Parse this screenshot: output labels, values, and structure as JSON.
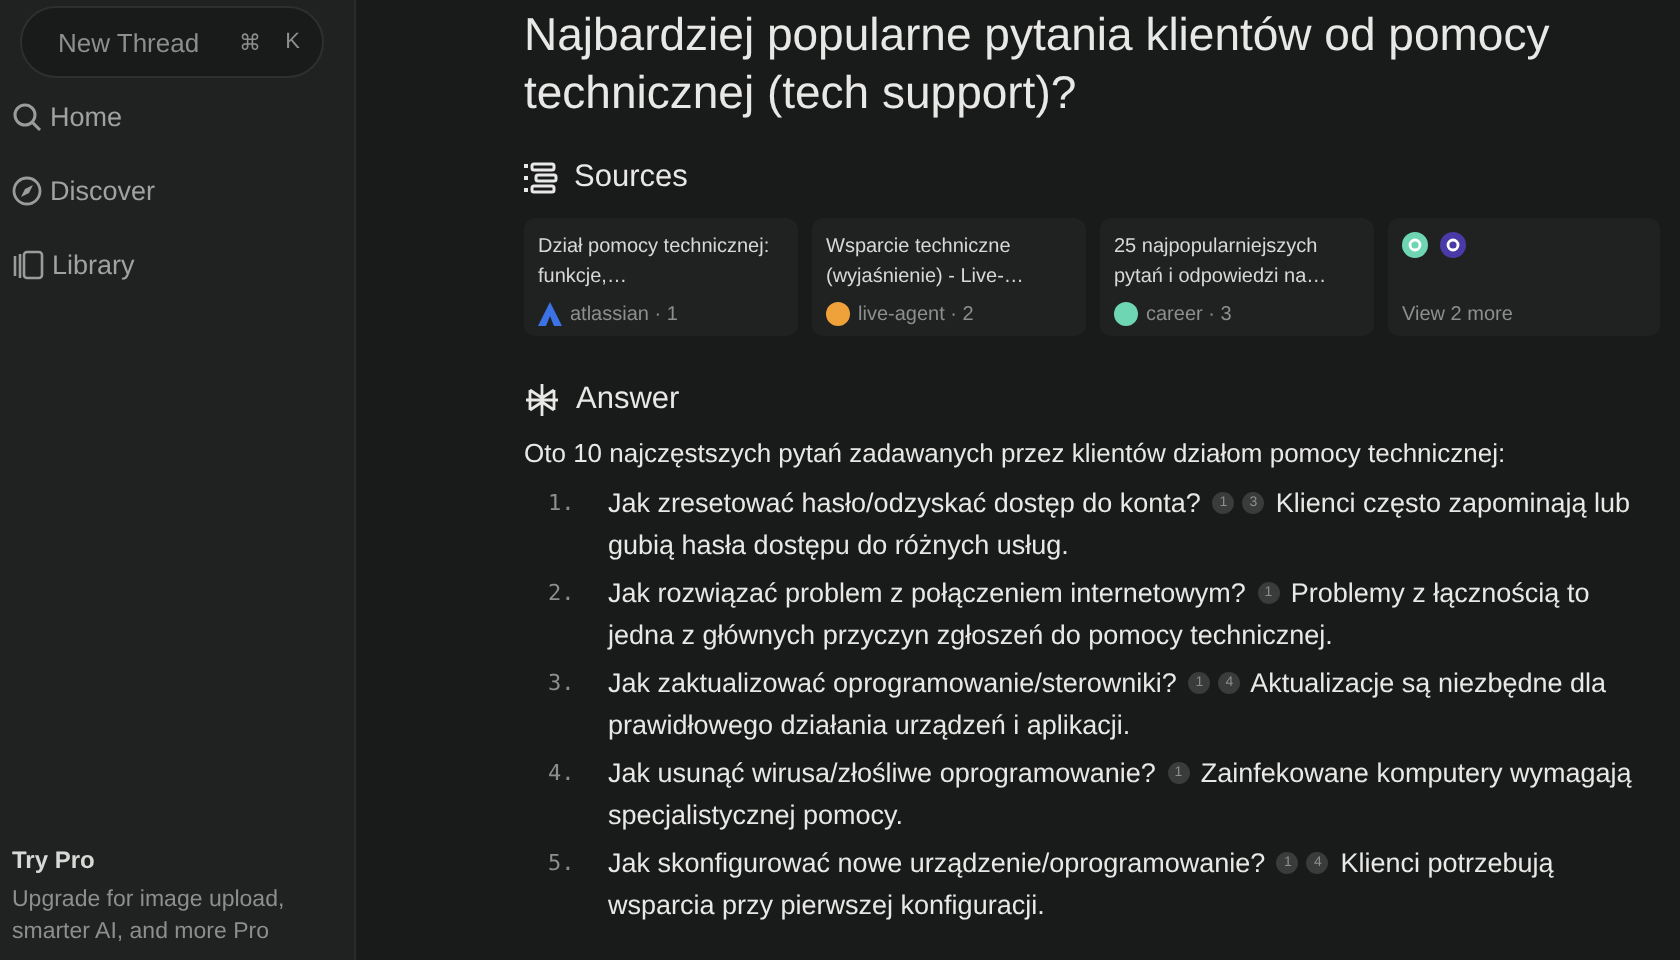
{
  "sidebar": {
    "new_thread": {
      "label": "New Thread",
      "keys": [
        "⌘",
        "K"
      ]
    },
    "items": [
      {
        "kind": "search",
        "label": "Home"
      },
      {
        "kind": "compass",
        "label": "Discover"
      },
      {
        "kind": "library",
        "label": "Library"
      }
    ],
    "promo": {
      "title": "Try Pro",
      "text": "Upgrade for image upload, smarter AI, and more Pro"
    }
  },
  "thread": {
    "title": "Najbardziej popularne pytania klientów od pomocy technicznej (tech support)?",
    "sources": {
      "heading": "Sources",
      "cards": [
        {
          "title": "Dział pomocy technicznej: funkcje,…",
          "site": "atlassian · 1",
          "kind": "triangle",
          "color": "#3b73e6"
        },
        {
          "title": "Wsparcie techniczne (wyjaśnienie) - Live-…",
          "site": "live-agent · 2",
          "kind": "circle",
          "color": "#f0a23a"
        },
        {
          "title": "25 najpopularniejszych pytań i odpowiedzi na…",
          "site": "career · 3",
          "kind": "circle",
          "color": "#6fd6b4"
        }
      ],
      "more": {
        "label": "View 2 more",
        "icons": [
          {
            "color": "#6fd6b4"
          },
          {
            "color": "#4a3aa8"
          }
        ]
      }
    },
    "answer": {
      "heading": "Answer",
      "intro": "Oto 10 najczęstszych pytań zadawanych przez klientów działom pomocy technicznej:",
      "items": [
        {
          "number": "1.",
          "question": "Jak zresetować hasło/odzyskać dostęp do konta?",
          "citations": [
            "1",
            "3"
          ],
          "text": "Klienci często zapominają lub gubią hasła dostępu do różnych usług."
        },
        {
          "number": "2.",
          "question": "Jak rozwiązać problem z połączeniem internetowym?",
          "citations": [
            "1"
          ],
          "text": "Problemy z łącznością to jedna z głównych przyczyn zgłoszeń do pomocy technicznej."
        },
        {
          "number": "3.",
          "question": "Jak zaktualizować oprogramowanie/sterowniki?",
          "citations": [
            "1",
            "4"
          ],
          "text": "Aktualizacje są niezbędne dla prawidłowego działania urządzeń i aplikacji."
        },
        {
          "number": "4.",
          "question": "Jak usunąć wirusa/złośliwe oprogramowanie?",
          "citations": [
            "1"
          ],
          "text": "Zainfekowane komputery wymagają specjalistycznej pomocy."
        },
        {
          "number": "5.",
          "question": "Jak skonfigurować nowe urządzenie/oprogramowanie?",
          "citations": [
            "1",
            "4"
          ],
          "text": "Klienci potrzebują wsparcia przy pierwszej konfiguracji."
        }
      ]
    }
  }
}
